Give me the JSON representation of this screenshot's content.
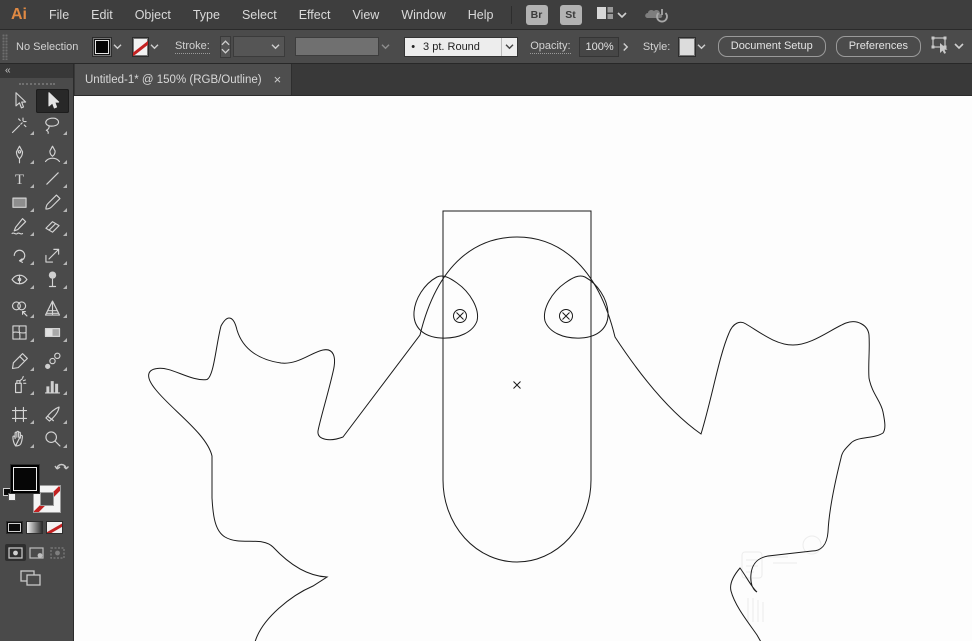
{
  "colors": {
    "chrome": "#4B4B4B",
    "chrome_dark": "#393939",
    "accent_orange": "#E08943",
    "none_slash_red": "#C32222",
    "canvas_white": "#FDFDFD",
    "outline_stroke": "#1A1A1A"
  },
  "menu_bar": {
    "logo": "Ai",
    "items": [
      "File",
      "Edit",
      "Object",
      "Type",
      "Select",
      "Effect",
      "View",
      "Window",
      "Help"
    ],
    "bridge_label": "Br",
    "stock_label": "St"
  },
  "control_bar": {
    "selection_status": "No Selection",
    "stroke_label": "Stroke:",
    "brush_bullet": "•",
    "brush_value": "3 pt. Round",
    "opacity_label": "Opacity:",
    "opacity_value": "100%",
    "style_label": "Style:",
    "document_setup_label": "Document Setup",
    "preferences_label": "Preferences"
  },
  "tab": {
    "title": "Untitled-1* @ 150% (RGB/Outline)",
    "close_glyph": "×",
    "zoom_level": "150%",
    "color_mode": "RGB/Outline"
  },
  "tool_panel": {
    "collapse_glyph": "«",
    "tools": [
      {
        "name": "direct-selection",
        "active": false
      },
      {
        "name": "selection",
        "active": true
      },
      {
        "name": "magic-wand",
        "active": false
      },
      {
        "name": "lasso",
        "active": false
      },
      {
        "name": "pen",
        "active": false
      },
      {
        "name": "curvature",
        "active": false
      },
      {
        "name": "type",
        "active": false
      },
      {
        "name": "line-segment",
        "active": false
      },
      {
        "name": "rectangle",
        "active": false
      },
      {
        "name": "paintbrush",
        "active": false
      },
      {
        "name": "shaper",
        "active": false
      },
      {
        "name": "eraser",
        "active": false
      },
      {
        "name": "rotate",
        "active": false
      },
      {
        "name": "scale",
        "active": false
      },
      {
        "name": "width",
        "active": false
      },
      {
        "name": "puppet-warp",
        "active": false
      },
      {
        "name": "shape-builder",
        "active": false
      },
      {
        "name": "perspective-grid",
        "active": false
      },
      {
        "name": "mesh",
        "active": false
      },
      {
        "name": "gradient",
        "active": false
      },
      {
        "name": "eyedropper",
        "active": false
      },
      {
        "name": "blend",
        "active": false
      },
      {
        "name": "symbol-sprayer",
        "active": false
      },
      {
        "name": "column-graph",
        "active": false
      },
      {
        "name": "artboard",
        "active": false
      },
      {
        "name": "slice",
        "active": false
      },
      {
        "name": "hand",
        "active": false
      },
      {
        "name": "zoom",
        "active": false
      }
    ]
  }
}
